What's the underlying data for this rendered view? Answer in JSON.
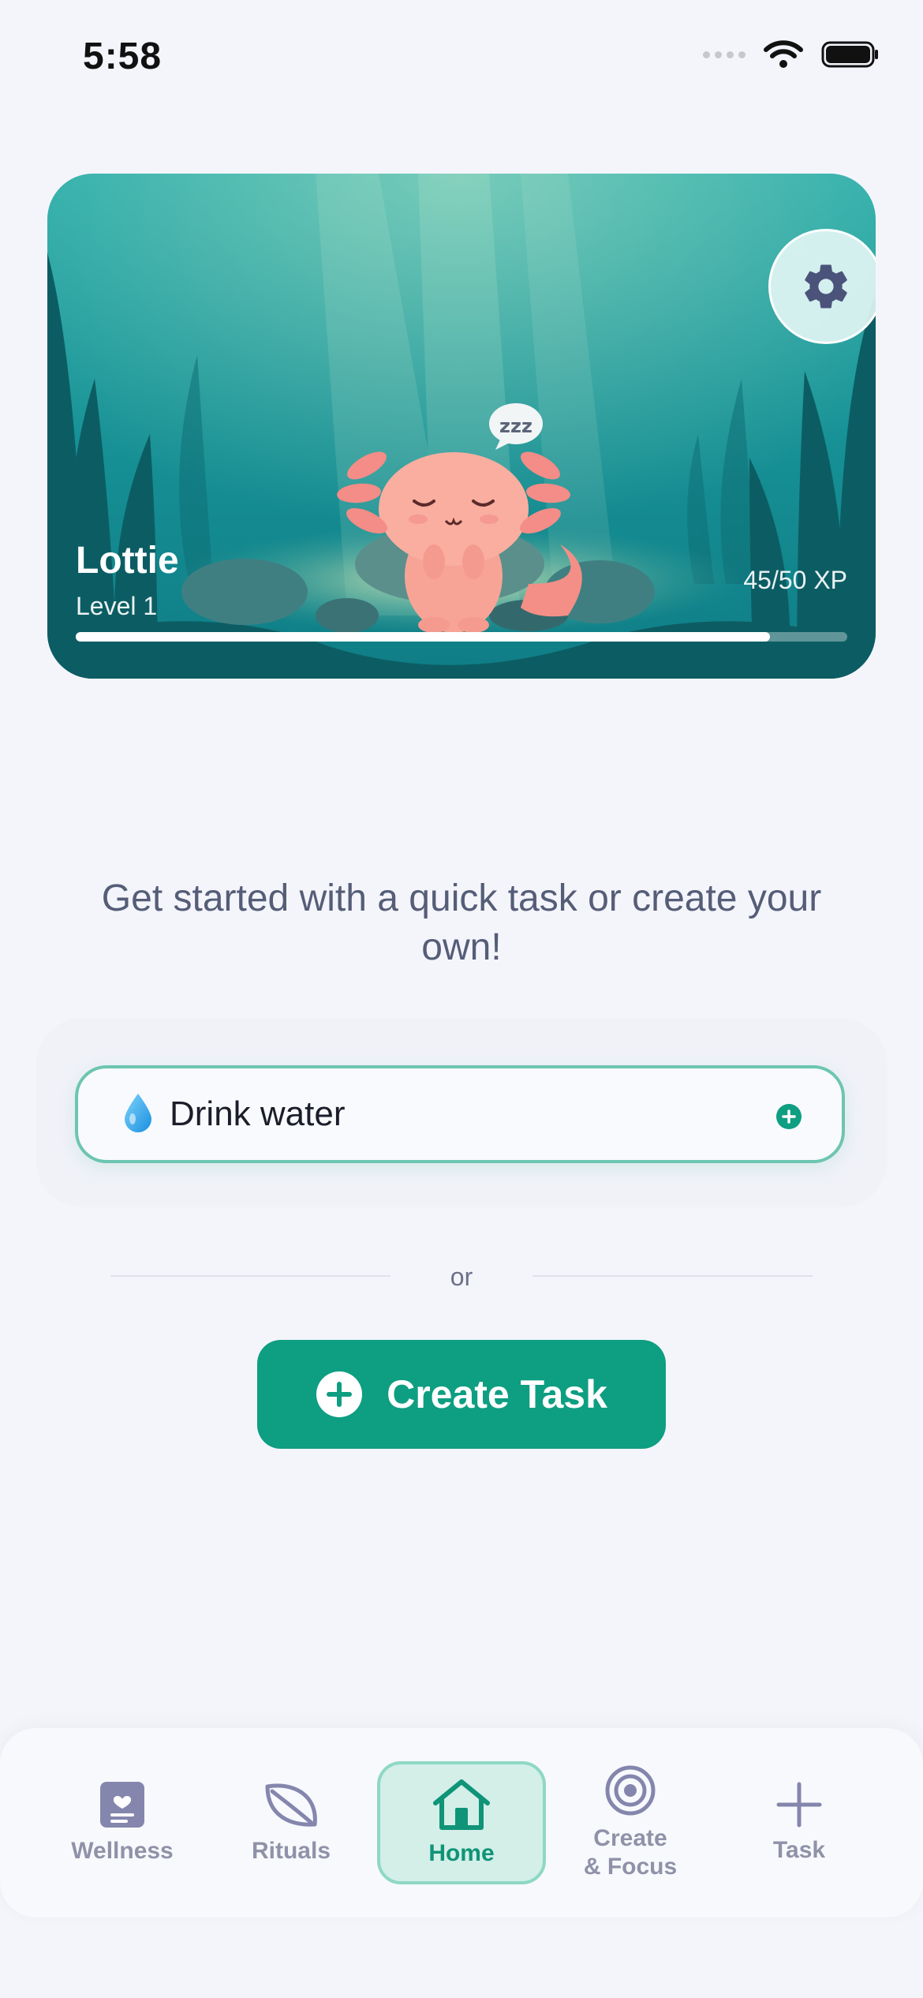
{
  "status_bar": {
    "time": "5:58"
  },
  "pet": {
    "name": "Lottie",
    "level": "Level 1",
    "xp_text": "45/50 XP",
    "xp_progress": 0.9,
    "sleep_text": "zzz"
  },
  "prompt": "Get started with a quick task or create your own!",
  "quick_task": {
    "emoji": "💧",
    "label": "Drink water"
  },
  "divider_text": "or",
  "create_task_label": "Create Task",
  "tabs": [
    {
      "label": "Wellness",
      "icon": "journal-heart-icon"
    },
    {
      "label": "Rituals",
      "icon": "leaf-icon"
    },
    {
      "label": "Home",
      "icon": "home-icon",
      "active": true
    },
    {
      "label": "Create\n& Focus",
      "icon": "target-icon"
    },
    {
      "label": "Task",
      "icon": "plus-icon"
    }
  ],
  "colors": {
    "accent": "#0e9e82",
    "card": "#179498",
    "background": "#f4f5fb"
  }
}
